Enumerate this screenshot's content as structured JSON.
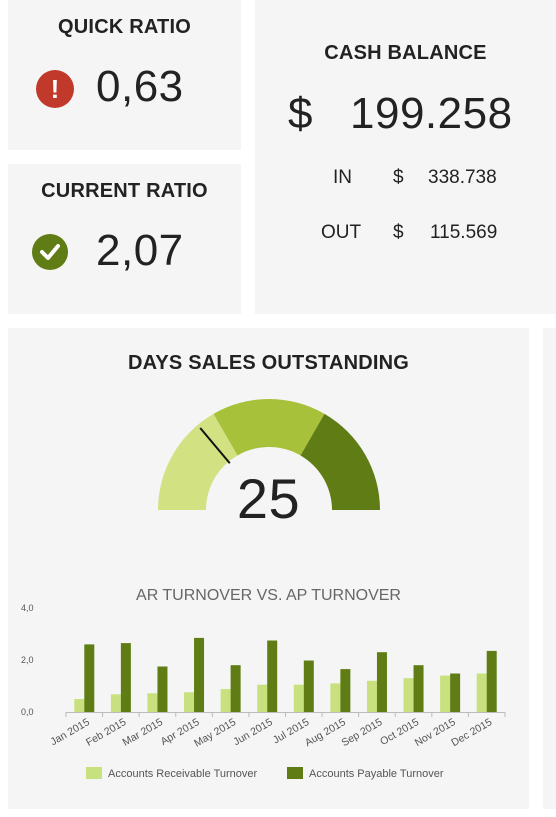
{
  "quick_ratio": {
    "title": "QUICK RATIO",
    "value": "0,63",
    "status": "warning",
    "icon": "exclamation-icon",
    "color": "#c0392b"
  },
  "current_ratio": {
    "title": "CURRENT RATIO",
    "value": "2,07",
    "status": "ok",
    "icon": "checkmark-icon",
    "color": "#5f7d14"
  },
  "cash_balance": {
    "title": "CASH BALANCE",
    "currency": "$",
    "value": "199.258",
    "in_label": "IN",
    "in_currency": "$",
    "in_value": "338.738",
    "out_label": "OUT",
    "out_currency": "$",
    "out_value": "115.569"
  },
  "dso": {
    "title": "DAYS SALES OUTSTANDING",
    "value": "25",
    "gauge": {
      "min": 0,
      "max": 90,
      "value": 25,
      "bands": [
        30,
        60,
        90
      ],
      "band_colors": [
        "#d2e283",
        "#a8c13a",
        "#5f7d14"
      ]
    }
  },
  "chart_data": {
    "type": "bar",
    "title": "AR TURNOVER VS. AP TURNOVER",
    "categories": [
      "Jan 2015",
      "Feb 2015",
      "Mar 2015",
      "Apr 2015",
      "May 2015",
      "Jun 2015",
      "Jul 2015",
      "Aug 2015",
      "Sep 2015",
      "Oct 2015",
      "Nov 2015",
      "Dec 2015"
    ],
    "series": [
      {
        "name": "Accounts Receivable Turnover",
        "color": "#c8e07d",
        "values": [
          0.5,
          0.68,
          0.72,
          0.76,
          0.88,
          1.05,
          1.05,
          1.1,
          1.2,
          1.3,
          1.4,
          1.48
        ]
      },
      {
        "name": "Accounts Payable Turnover",
        "color": "#5f7d14",
        "values": [
          2.6,
          2.65,
          1.75,
          2.85,
          1.8,
          2.75,
          1.98,
          1.65,
          2.3,
          1.8,
          1.48,
          2.35
        ]
      }
    ],
    "ylim": [
      0,
      4
    ],
    "yticks": [
      "0,0",
      "2,0",
      "4,0"
    ],
    "legend_position": "bottom"
  }
}
